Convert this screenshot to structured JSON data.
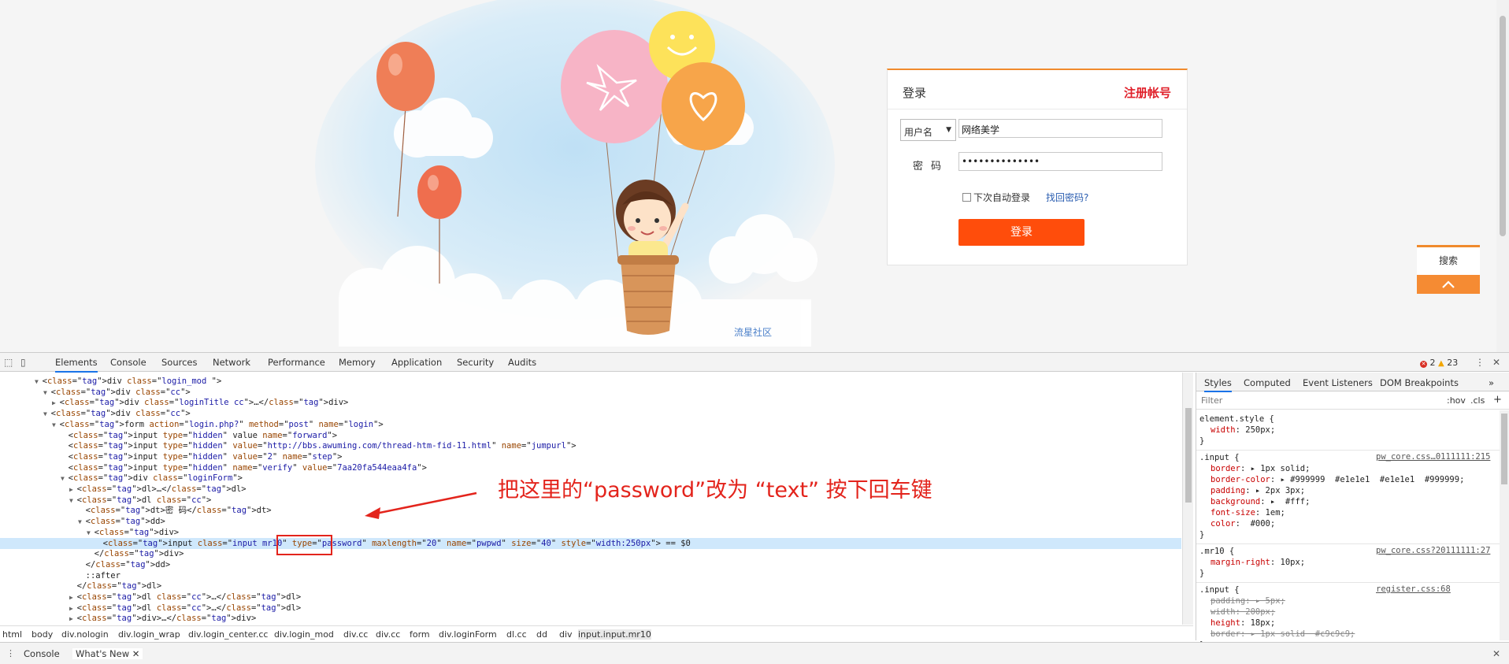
{
  "webpage": {
    "site_link": "流星社区",
    "login": {
      "title": "登录",
      "register_link": "注册帐号",
      "user_type_select": "用户名",
      "username_value": "网络美学",
      "password_label": "密码",
      "password_value": "••••••••••••••",
      "remember_label": "下次自动登录",
      "forgot_link": "找回密码?",
      "submit_label": "登录"
    },
    "side": {
      "search_label": "搜索",
      "top_icon": "chevron-up-icon"
    }
  },
  "devtools": {
    "tabs": [
      "Elements",
      "Console",
      "Sources",
      "Network",
      "Performance",
      "Memory",
      "Application",
      "Security",
      "Audits"
    ],
    "active_tab": "Elements",
    "error_count": "2",
    "warning_count": "23",
    "dom_lines": [
      {
        "indent": 4,
        "arrow": "▼",
        "html": "<div class=\"login_mod \">"
      },
      {
        "indent": 5,
        "arrow": "▼",
        "html": "<div class=\"cc\">"
      },
      {
        "indent": 6,
        "arrow": "▶",
        "html": "<div class=\"loginTitle cc\">…</div>"
      },
      {
        "indent": 5,
        "arrow": "▼",
        "html": "<div class=\"cc\">"
      },
      {
        "indent": 6,
        "arrow": "▼",
        "html": "<form action=\"login.php?\" method=\"post\" name=\"login\">"
      },
      {
        "indent": 7,
        "arrow": "",
        "html": "<input type=\"hidden\" value name=\"forward\">"
      },
      {
        "indent": 7,
        "arrow": "",
        "html": "<input type=\"hidden\" value=\"http://bbs.awuming.com/thread-htm-fid-11.html\" name=\"jumpurl\">"
      },
      {
        "indent": 7,
        "arrow": "",
        "html": "<input type=\"hidden\" value=\"2\" name=\"step\">"
      },
      {
        "indent": 7,
        "arrow": "",
        "html": "<input type=\"hidden\" name=\"verify\" value=\"7aa20fa544eaa4fa\">"
      },
      {
        "indent": 7,
        "arrow": "▼",
        "html": "<div class=\"loginForm\">"
      },
      {
        "indent": 8,
        "arrow": "▶",
        "html": "<dl>…</dl>"
      },
      {
        "indent": 8,
        "arrow": "▼",
        "html": "<dl class=\"cc\">"
      },
      {
        "indent": 9,
        "arrow": "",
        "html": "<dt>密 码</dt>"
      },
      {
        "indent": 9,
        "arrow": "▼",
        "html": "<dd>"
      },
      {
        "indent": 10,
        "arrow": "▼",
        "html": "<div>"
      },
      {
        "indent": 11,
        "arrow": "",
        "html": "<input class=\"input mr10\" type=\"password\" maxlength=\"20\" name=\"pwpwd\" size=\"40\" style=\"width:250px\"> == $0",
        "selected": true
      },
      {
        "indent": 10,
        "arrow": "",
        "html": "</div>"
      },
      {
        "indent": 9,
        "arrow": "",
        "html": "</dd>"
      },
      {
        "indent": 9,
        "arrow": "",
        "html": "::after"
      },
      {
        "indent": 8,
        "arrow": "",
        "html": "</dl>"
      },
      {
        "indent": 8,
        "arrow": "▶",
        "html": "<dl class=\"cc\">…</dl>"
      },
      {
        "indent": 8,
        "arrow": "▶",
        "html": "<dl class=\"cc\">…</dl>"
      },
      {
        "indent": 8,
        "arrow": "▶",
        "html": "<div>…</div>"
      }
    ],
    "annotation": "把这里的“password”改为 “text” 按下回车键",
    "breadcrumb": [
      "html",
      "body",
      "div.nologin",
      "div.login_wrap",
      "div.login_center.cc",
      "div.login_mod",
      "div.cc",
      "div.cc",
      "form",
      "div.loginForm",
      "dl.cc",
      "dd",
      "div",
      "input.input.mr10"
    ],
    "drawer_tabs": [
      "Console",
      "What's New"
    ],
    "styles_tabs": [
      "Styles",
      "Computed",
      "Event Listeners",
      "DOM Breakpoints"
    ],
    "filter_placeholder": "Filter",
    "hov_label": ":hov",
    "cls_label": ".cls",
    "rules": [
      {
        "selector": "element.style {",
        "source": "",
        "props": [
          "width: 250px;"
        ]
      },
      {
        "selector": ".input {",
        "source": "pw_core.css…0111111:215",
        "props": [
          "border: ▸ 1px solid;",
          "border-color: ▸ #999999  #e1e1e1  #e1e1e1  #999999;",
          "padding: ▸ 2px 3px;",
          "background: ▸  #fff;",
          "font-size: 1em;",
          "color:  #000;"
        ]
      },
      {
        "selector": ".mr10 {",
        "source": "pw_core.css?20111111:27",
        "props": [
          "margin-right: 10px;"
        ]
      },
      {
        "selector": ".input {",
        "source": "register.css:68",
        "props": [
          "padding: ▸ 5px;",
          "width: 200px;",
          "height: 18px;",
          "border: ▸ 1px solid  #c9c9c9;"
        ]
      }
    ]
  }
}
